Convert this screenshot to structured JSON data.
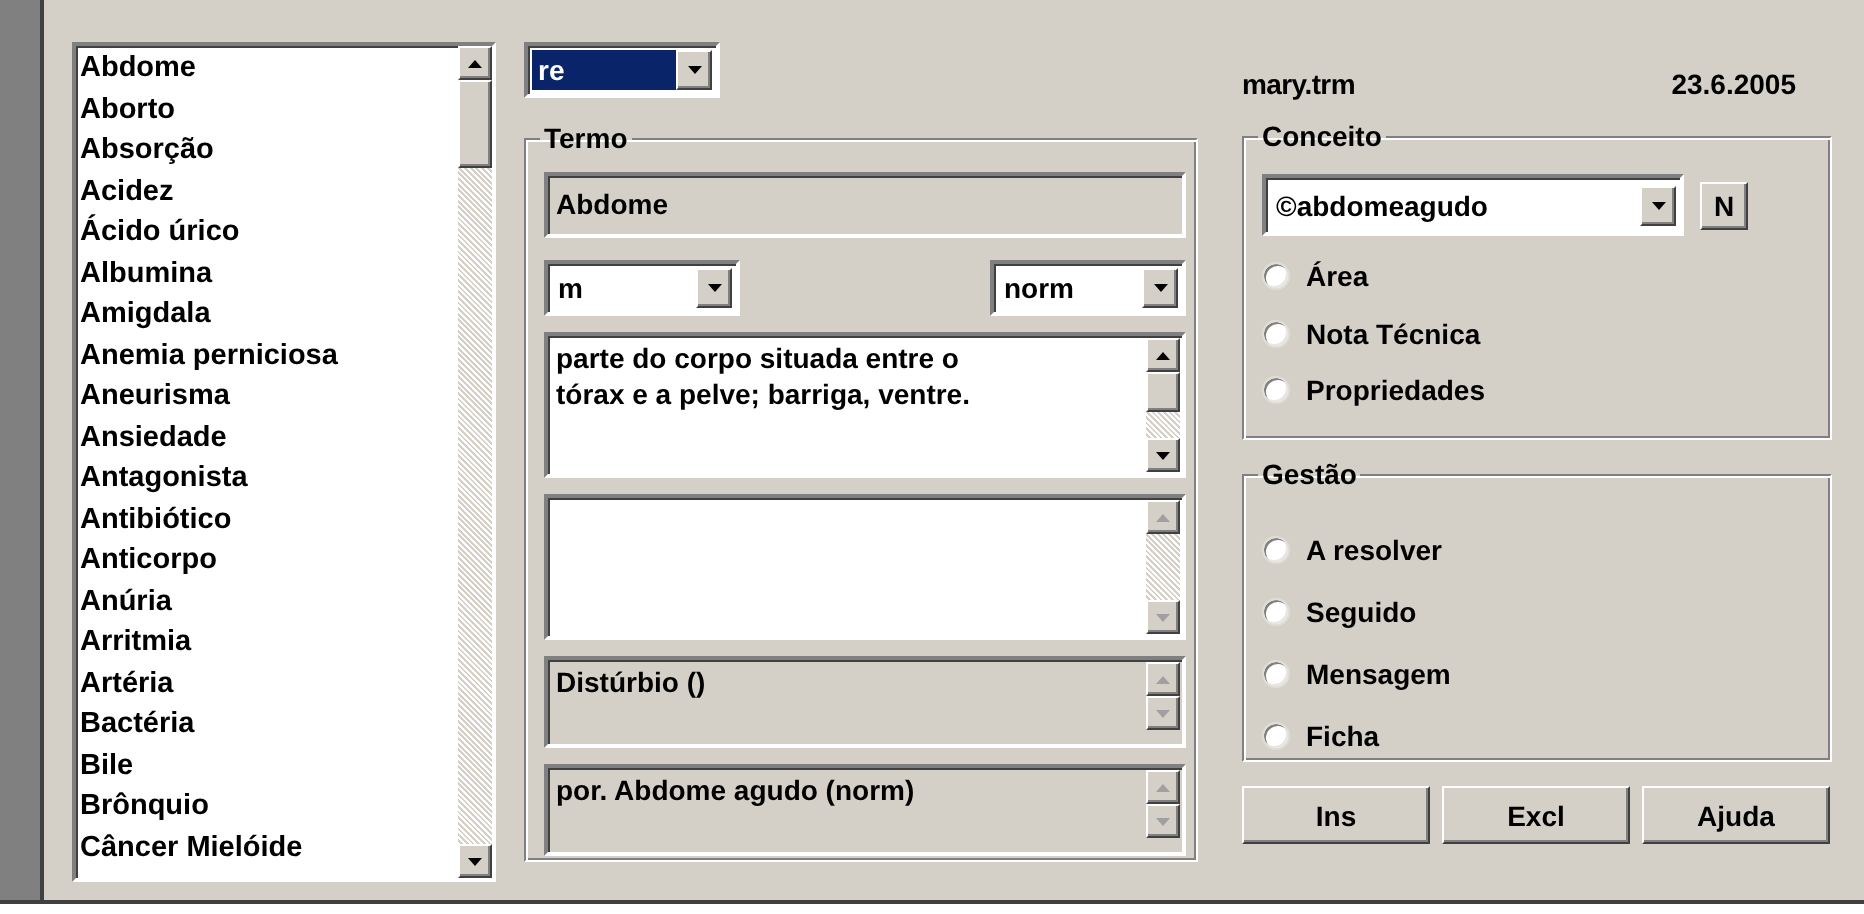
{
  "term_list": {
    "items": [
      {
        "label": "Abdome",
        "selected": false
      },
      {
        "label": "Aborto",
        "selected": false
      },
      {
        "label": "Absorção",
        "selected": false
      },
      {
        "label": "Acidez",
        "selected": false
      },
      {
        "label": "Ácido úrico",
        "selected": false
      },
      {
        "label": "Albumina",
        "selected": false
      },
      {
        "label": "Amigdala",
        "selected": false
      },
      {
        "label": "Anemia perniciosa",
        "selected": false
      },
      {
        "label": "Aneurisma",
        "selected": false
      },
      {
        "label": "Ansiedade",
        "selected": false
      },
      {
        "label": "Antagonista",
        "selected": false
      },
      {
        "label": "Antibiótico",
        "selected": false
      },
      {
        "label": "Anticorpo",
        "selected": false
      },
      {
        "label": "Anúria",
        "selected": false
      },
      {
        "label": "Arritmia",
        "selected": false
      },
      {
        "label": "Artéria",
        "selected": false
      },
      {
        "label": "Bactéria",
        "selected": false
      },
      {
        "label": "Bile",
        "selected": false
      },
      {
        "label": "Brônquio",
        "selected": false
      },
      {
        "label": "Câncer Mielóide",
        "selected": false
      }
    ]
  },
  "language_select": {
    "value": "re",
    "highlighted": true
  },
  "file_name": "mary.trm",
  "date": "23.6.2005",
  "termo": {
    "title": "Termo",
    "term": "Abdome",
    "gender_select": {
      "value": "m"
    },
    "status_select": {
      "value": "norm"
    },
    "definition": "parte do corpo situada entre o tórax e a pelve; barriga, ventre.",
    "category": "Distúrbio ()",
    "relation": "por. Abdome agudo (norm)"
  },
  "conceito": {
    "title": "Conceito",
    "concept_select": {
      "value": "©abdomeagudo"
    },
    "new_button": "N",
    "options": [
      {
        "label": "Área",
        "selected": false
      },
      {
        "label": "Nota Técnica",
        "selected": false
      },
      {
        "label": "Propriedades",
        "selected": false
      }
    ]
  },
  "gestao": {
    "title": "Gestão",
    "options": [
      {
        "label": "A resolver",
        "selected": false
      },
      {
        "label": "Seguido",
        "selected": false
      },
      {
        "label": "Mensagem",
        "selected": false
      },
      {
        "label": "Ficha",
        "selected": false
      }
    ]
  },
  "buttons": [
    "Ins",
    "Excl",
    "Ajuda"
  ]
}
